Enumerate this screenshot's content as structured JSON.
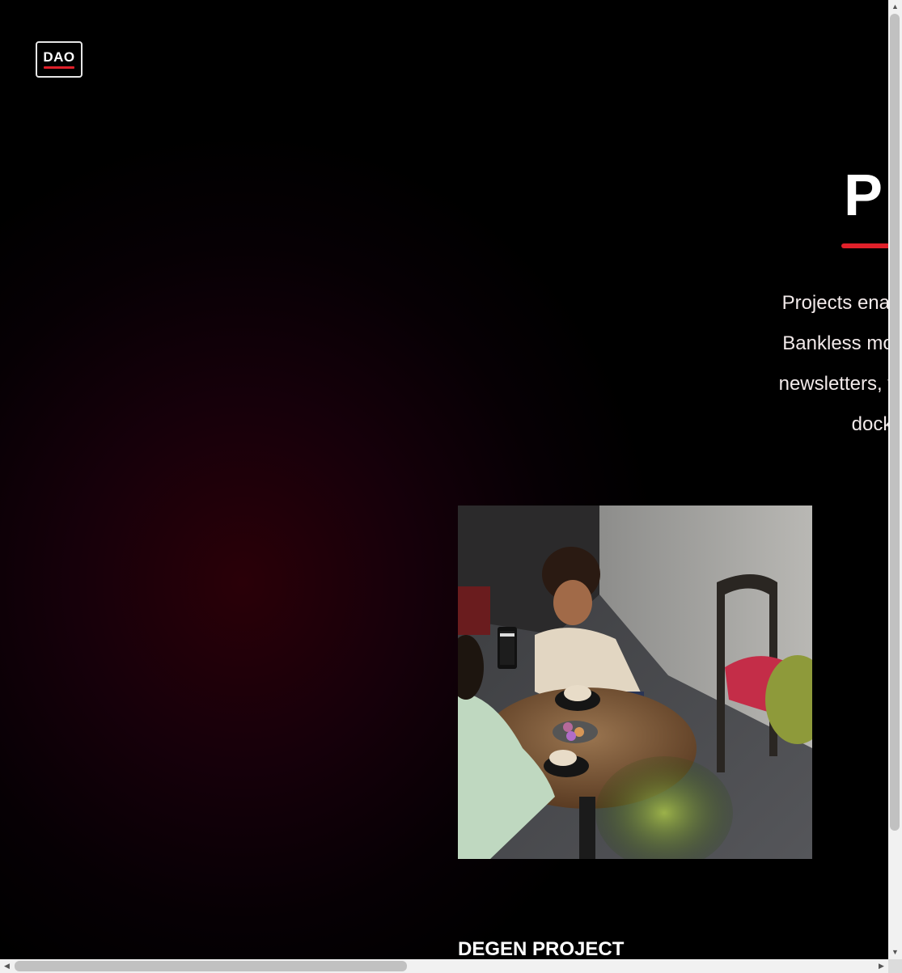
{
  "logo": {
    "text": "DAO"
  },
  "hero": {
    "title": "P",
    "intro_lines": [
      "Projects enable Guilds and",
      "Bankless movement. From",
      "newsletters, we have multip",
      "docket. He"
    ]
  },
  "project": {
    "image_alt": "Two people at a cafe table with coffee and macarons, one holding a phone",
    "heading": "DEGEN PROJECT"
  },
  "colors": {
    "accent": "#e0202a",
    "background": "#000000",
    "text": "#ffffff"
  },
  "icons": [
    "scroll-up-icon",
    "scroll-down-icon",
    "scroll-left-icon",
    "scroll-right-icon"
  ]
}
